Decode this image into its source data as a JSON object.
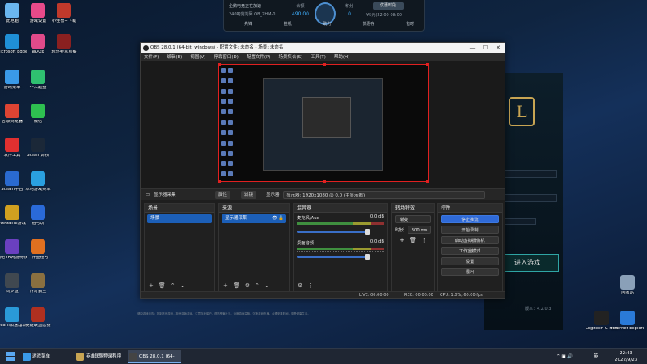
{
  "desktop": {
    "icons": [
      {
        "label": "此电脑",
        "color": "#6ab6f0"
      },
      {
        "label": "游戏设置",
        "color": "#e84a8a"
      },
      {
        "label": "小怪兽+下载",
        "color": "#c0392b"
      },
      {
        "label": "Microsoft Edge",
        "color": "#1f8fd6"
      },
      {
        "label": "输入法",
        "color": "#e04a8a"
      },
      {
        "label": "玩外卖盒点餐",
        "color": "#8a2020"
      },
      {
        "label": "游戏菜单",
        "color": "#3a9ae8"
      },
      {
        "label": "个人越盘",
        "color": "#2fc070"
      },
      {
        "label": "谷歌浏览器",
        "color": "#dd4433"
      },
      {
        "label": "微信",
        "color": "#2ec050"
      },
      {
        "label": "软件工具",
        "color": "#e03030"
      },
      {
        "label": "Steam饰权",
        "color": "#1b2838"
      },
      {
        "label": "Steam平台",
        "color": "#2a6ad0"
      },
      {
        "label": "本地游戏菜单",
        "color": "#2aa0e0"
      },
      {
        "label": "WeGame游戏",
        "color": "#d0a020"
      },
      {
        "label": "租号玩",
        "color": "#2a6ad8"
      },
      {
        "label": "网吧VR网游特权",
        "color": "#6a40c0"
      },
      {
        "label": "一件金租号",
        "color": "#e07020"
      },
      {
        "label": "同步盘",
        "color": "#404850"
      },
      {
        "label": "传奇霸主",
        "color": "#8a7040"
      },
      {
        "label": "Steam加速器本地专用",
        "color": "#2a9ad8"
      },
      {
        "label": "英雄联盟比赛",
        "color": "#b03020"
      }
    ],
    "right_icons": [
      {
        "label": "回收站",
        "color": "#8aa0b8"
      },
      {
        "label": "Logitech G HUB",
        "color": "#222"
      },
      {
        "label": "Internet Explorer",
        "color": "#2a7ad8"
      }
    ]
  },
  "booster": {
    "line1": "企鹅电竞正在加速",
    "line2": "240吧剑刘网 OB_ZHM-0...",
    "stat1_label": "余额",
    "stat1_value": "490.00",
    "stat2_label": "积分",
    "stat2_value": "0",
    "opt_button": "优惠时段",
    "opt_time": "¥5元(22:00-08:00",
    "bar": [
      "先锋",
      "挂机",
      "助力",
      "优惠存",
      "包时"
    ]
  },
  "lol": {
    "logo": "L",
    "play_button": "进入游戏",
    "version": "版本：4.2.0.3"
  },
  "obs": {
    "title": "OBS 28.0.1 (64-bit, windows) - 配置文件: 未命名 - 场景: 未命名",
    "controls": [
      "—",
      "☐",
      "✕"
    ],
    "menu": [
      "文件(F)",
      "编辑(E)",
      "视图(V)",
      "停靠窗口(D)",
      "配置文件(P)",
      "场景集合(S)",
      "工具(T)",
      "帮助(H)"
    ],
    "source_bar": {
      "source_name": "显示器采集",
      "properties": "属性",
      "filters": "滤镜",
      "display_label": "显示器",
      "display_value": "显示器: 1920x1080 @ 0,0 (主显示器)"
    },
    "scenes": {
      "header": "场景",
      "items": [
        "场景"
      ]
    },
    "sources": {
      "header": "来源",
      "items": [
        "显示器采集"
      ]
    },
    "mixer": {
      "header": "混音器",
      "channels": [
        {
          "name": "麦克风/Aux",
          "db": "0.0 dB"
        },
        {
          "name": "桌面音频",
          "db": "0.0 dB"
        }
      ]
    },
    "transitions": {
      "header": "转场特效",
      "type": "渐变",
      "duration_label": "时长",
      "duration_value": "300 ms"
    },
    "controls_dock": {
      "header": "控件",
      "buttons": [
        "停止推流",
        "开始录制",
        "启动虚拟摄像机",
        "工作室模式",
        "设置",
        "退出"
      ]
    },
    "status": {
      "live": "LIVE: 00:00:00",
      "rec": "REC: 00:00:00",
      "cpu": "CPU: 1.0%, 60.00 fps"
    }
  },
  "lol_footer": "健康游戏忠告：抵制不良游戏，拒绝盗版游戏。注意自我保护，谨防受骗上当。适度游戏益脑，沉迷游戏伤身。合理安排时间，享受健康生活。",
  "taskbar": {
    "items": [
      {
        "label": "游戏菜单",
        "color": "#3a9ae8"
      },
      {
        "label": "英雄联盟登录程序",
        "color": "#c8a553"
      },
      {
        "label": "OBS 28.0.1 (64-bi...",
        "color": "#444"
      }
    ],
    "ime": "英",
    "time": "22:43",
    "date": "2022/9/23"
  }
}
